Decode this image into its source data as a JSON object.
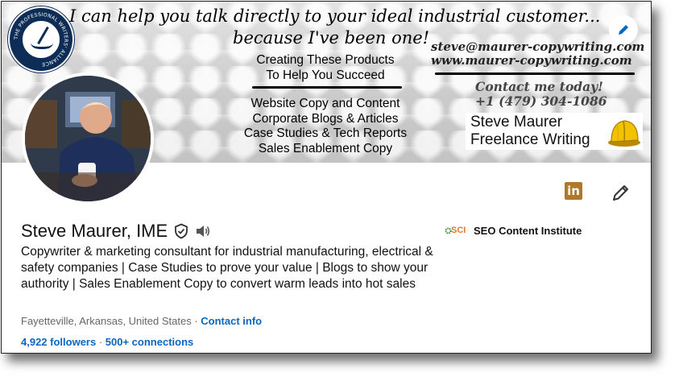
{
  "banner": {
    "headline_line1": "I can help you talk directly to your ideal industrial customer...",
    "headline_line2": "because I've been one!",
    "products_title_line1": "Creating These Products",
    "products_title_line2": "To Help You Succeed",
    "products": [
      "Website Copy and Content",
      "Corporate Blogs & Articles",
      "Case Studies & Tech Reports",
      "Sales Enablement Copy"
    ],
    "email": "steve@maurer-copywriting.com",
    "website": "www.maurer-copywriting.com",
    "contact_cta": "Contact me today!",
    "phone": "+1 (479) 304-1086",
    "brand_line1": "Steve Maurer",
    "brand_line2": "Freelance Writing",
    "seal_text": "THE PROFESSIONAL WRITERS' ALLIANCE"
  },
  "profile": {
    "name": "Steve Maurer, IME",
    "headline": "Copywriter & marketing consultant for industrial manufacturing, electrical & safety companies | Case Studies to prove your value | Blogs to show your authority | Sales Enablement Copy to convert warm leads into hot sales",
    "location": "Fayetteville, Arkansas, United States",
    "separator": " · ",
    "contact_info": "Contact info",
    "followers": "4,922 followers",
    "stats_separator": " · ",
    "connections": "500+ connections",
    "organization": "SEO Content Institute",
    "org_logo_text": "SCI"
  },
  "icons": {
    "linkedin": "linkedin-icon",
    "edit": "pencil-icon",
    "verified": "shield-check-icon",
    "pronunciation": "speaker-icon"
  },
  "colors": {
    "link": "#0a66c2",
    "linkedin_badge": "#b0782a"
  }
}
